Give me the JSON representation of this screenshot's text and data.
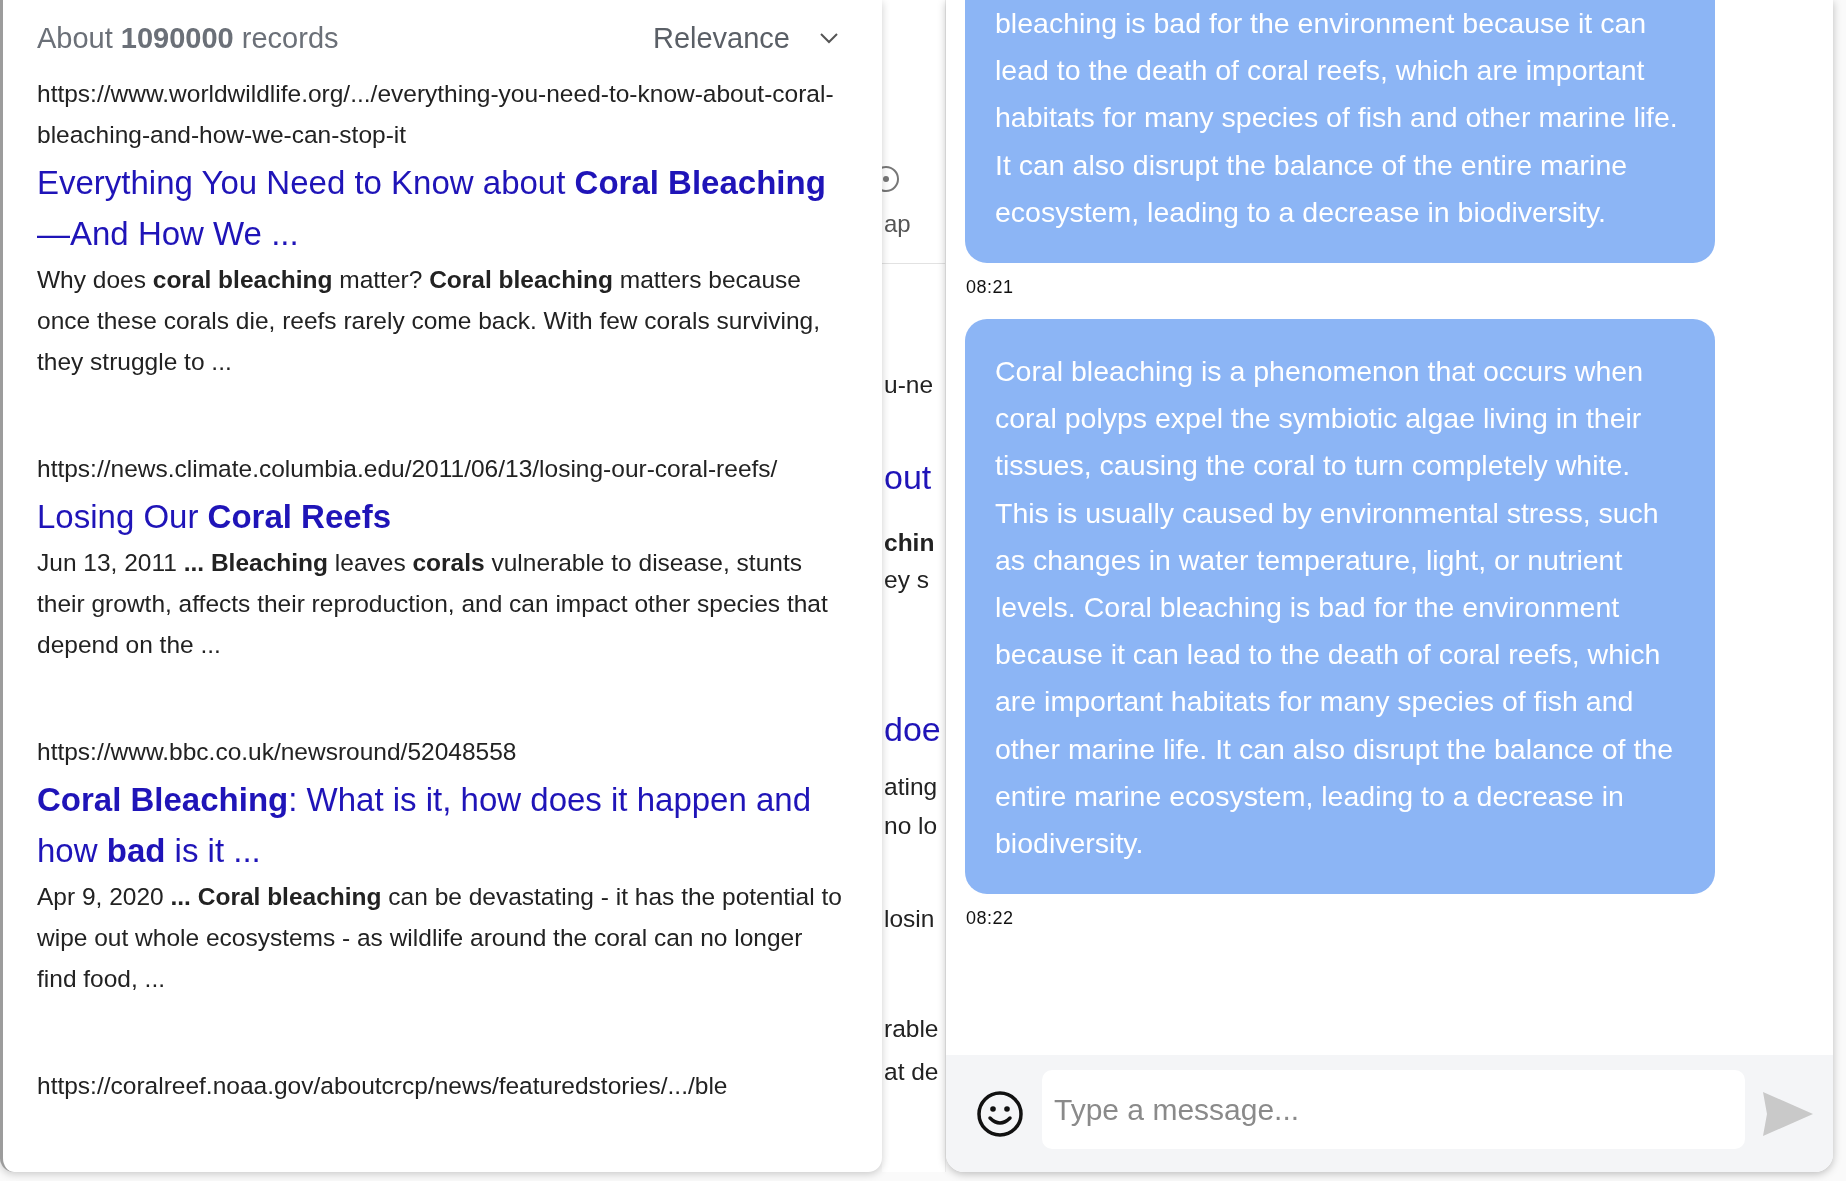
{
  "results_panel": {
    "summary": "About **1090000** records",
    "sort": {
      "label": "Relevance"
    },
    "results": [
      {
        "url": "https://www.worldwildlife.org/.../everything-you-need-to-know-about-coral- bleaching-and-how-we-can-stop-it",
        "title": "Everything You Need to Know about **Coral Bleaching**—And How We ...",
        "snippet": "Why does **coral bleaching** matter? **Coral bleaching** matters because once these corals die, reefs rarely come back. With few corals surviving, they struggle to ..."
      },
      {
        "url": "https://news.climate.columbia.edu/2011/06/13/losing-our-coral-reefs/",
        "title": "Losing Our **Coral Reefs**",
        "snippet": "Jun 13, 2011 **...** **Bleaching** leaves **corals** vulnerable to disease, stunts their growth, affects their reproduction, and can impact other species that depend on the ..."
      },
      {
        "url": "https://www.bbc.co.uk/newsround/52048558",
        "title": "**Coral Bleaching**: What is it, how does it happen and how **bad** is it ...",
        "snippet": "Apr 9, 2020 **...** **Coral bleaching** can be devastating - it has the potential to wipe out whole ecosystems - as wildlife around the coral can no longer find food, ..."
      },
      {
        "url": "https://coralreef.noaa.gov/aboutcrcp/news/featuredstories/.../ble"
      }
    ]
  },
  "background_page": [
    {
      "kind": "icon"
    },
    {
      "kind": "label",
      "text": "ap"
    },
    {
      "kind": "rule"
    },
    {
      "kind": "text",
      "text": "u-ne"
    },
    {
      "kind": "link",
      "text": "out"
    },
    {
      "kind": "bold",
      "text": "chin"
    },
    {
      "kind": "text",
      "text": "ey s"
    },
    {
      "kind": "link",
      "text": "doe"
    },
    {
      "kind": "text",
      "text": "ating"
    },
    {
      "kind": "text",
      "text": "no lo"
    },
    {
      "kind": "text",
      "text": "losin"
    },
    {
      "kind": "text",
      "text": "rable"
    },
    {
      "kind": "text",
      "text": "at de"
    }
  ],
  "chat": {
    "messages": [
      {
        "text": "bleaching is bad for the environment because it can lead to the death of coral reefs, which are important habitats for many species of fish and other marine life. It can also disrupt the balance of the entire marine ecosystem, leading to a decrease in biodiversity.",
        "time": "08:21",
        "cut_top": true
      },
      {
        "text": "Coral bleaching is a phenomenon that occurs when coral polyps expel the symbiotic algae living in their tissues, causing the coral to turn completely white. This is usually caused by environmental stress, such as changes in water temperature, light, or nutrient levels. Coral bleaching is bad for the environment because it can lead to the death of coral reefs, which are important habitats for many species of fish and other marine life. It can also disrupt the balance of the entire marine ecosystem, leading to a decrease in biodiversity.",
        "time": "08:22",
        "cut_top": false
      }
    ],
    "composer": {
      "placeholder": "Type a message..."
    }
  }
}
